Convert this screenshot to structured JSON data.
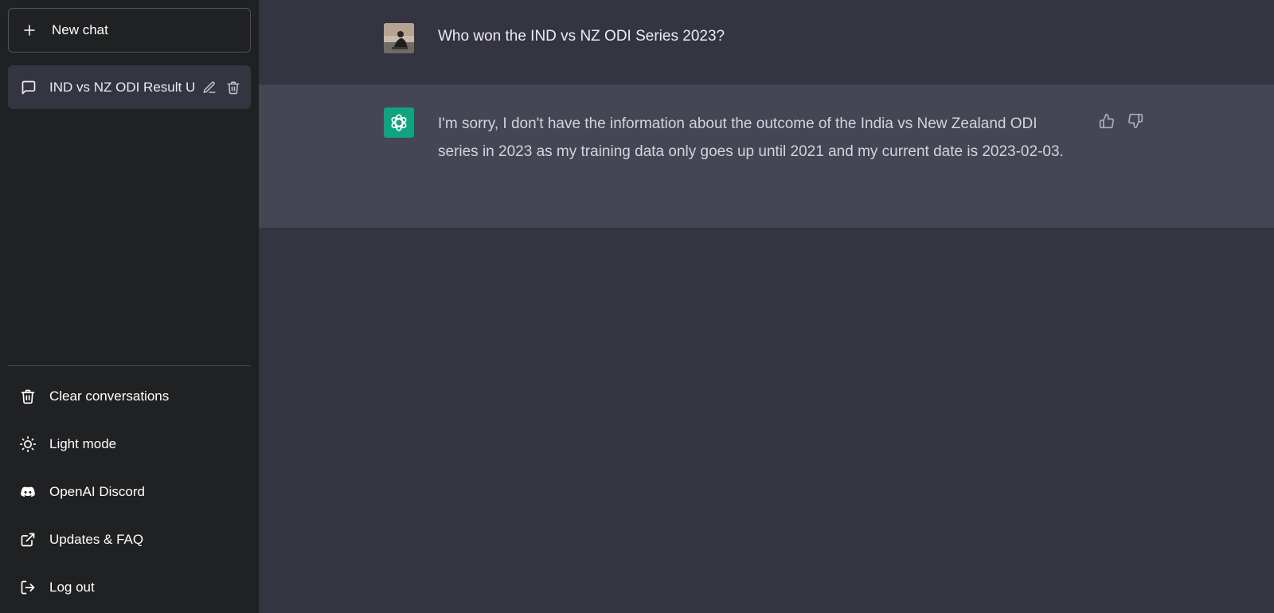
{
  "sidebar": {
    "new_chat_label": "New chat",
    "conversations": [
      {
        "title": "IND vs NZ ODI Result U"
      }
    ],
    "menu": [
      {
        "label": "Clear conversations",
        "icon": "trash-icon"
      },
      {
        "label": "Light mode",
        "icon": "sun-icon"
      },
      {
        "label": "OpenAI Discord",
        "icon": "discord-icon"
      },
      {
        "label": "Updates & FAQ",
        "icon": "external-link-icon"
      },
      {
        "label": "Log out",
        "icon": "logout-icon"
      }
    ]
  },
  "thread": {
    "user_message": "Who won the IND vs NZ ODI Series 2023?",
    "assistant_message": "I'm sorry, I don't have the information about the outcome of the India vs New Zealand ODI series in 2023 as my training data only goes up until 2021 and my current date is 2023-02-03."
  },
  "colors": {
    "sidebar_bg": "#202123",
    "main_bg": "#343541",
    "assistant_bg": "#444654",
    "brand_green": "#10a37f"
  }
}
